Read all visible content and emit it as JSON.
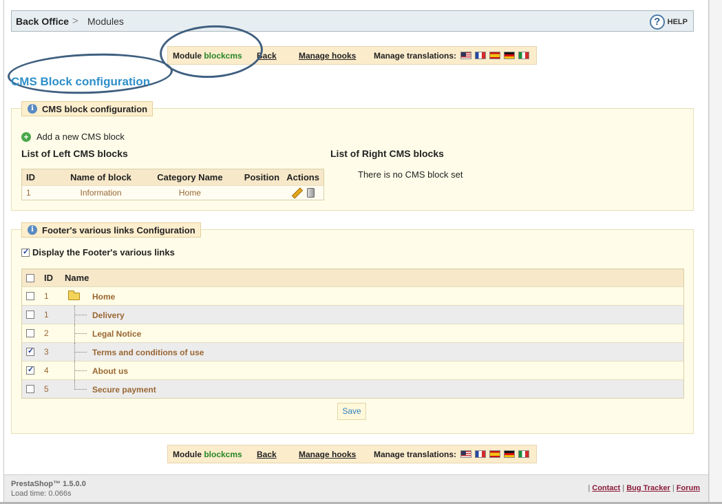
{
  "breadcrumb": {
    "root": "Back Office",
    "separator": ">",
    "current": "Modules"
  },
  "help": {
    "icon": "help-icon",
    "label": "HELP"
  },
  "module_bar": {
    "module_label": "Module",
    "module_name": "blockcms",
    "back": "Back",
    "manage_hooks": "Manage hooks",
    "manage_translations": "Manage translations:",
    "flags": [
      "us-flag-icon",
      "fr-flag-icon",
      "es-flag-icon",
      "de-flag-icon",
      "it-flag-icon"
    ]
  },
  "page_title": "CMS Block configuration",
  "cms_config": {
    "legend": "CMS block configuration",
    "add_label": "Add a new CMS block",
    "left_title": "List of Left CMS blocks",
    "right_title": "List of Right CMS blocks",
    "columns": [
      "ID",
      "Name of block",
      "Category Name",
      "Position",
      "Actions"
    ],
    "rows": [
      {
        "id": "1",
        "name": "Information",
        "category": "Home",
        "position": ""
      }
    ],
    "right_empty": "There is no CMS block set"
  },
  "footer_links": {
    "legend": "Footer's various links Configuration",
    "display_label": "Display the Footer's various links",
    "display_checked": true,
    "columns": {
      "id": "ID",
      "name": "Name"
    },
    "rows": [
      {
        "id": "1",
        "name": "Home",
        "checked": false,
        "folder": true
      },
      {
        "id": "1",
        "name": "Delivery",
        "checked": false,
        "folder": false
      },
      {
        "id": "2",
        "name": "Legal Notice",
        "checked": false,
        "folder": false
      },
      {
        "id": "3",
        "name": "Terms and conditions of use",
        "checked": true,
        "folder": false
      },
      {
        "id": "4",
        "name": "About us",
        "checked": true,
        "folder": false
      },
      {
        "id": "5",
        "name": "Secure payment",
        "checked": false,
        "folder": false
      }
    ],
    "save": "Save"
  },
  "footer": {
    "version": "PrestaShop™ 1.5.0.0",
    "load_time": "Load time: 0.066s",
    "links": [
      "Contact",
      "Bug Tracker",
      "Forum"
    ]
  },
  "colors": {
    "module_name": "#268626",
    "title": "#2e8fc9",
    "link_brown": "#996633",
    "annotation": "#3f5f7f"
  }
}
